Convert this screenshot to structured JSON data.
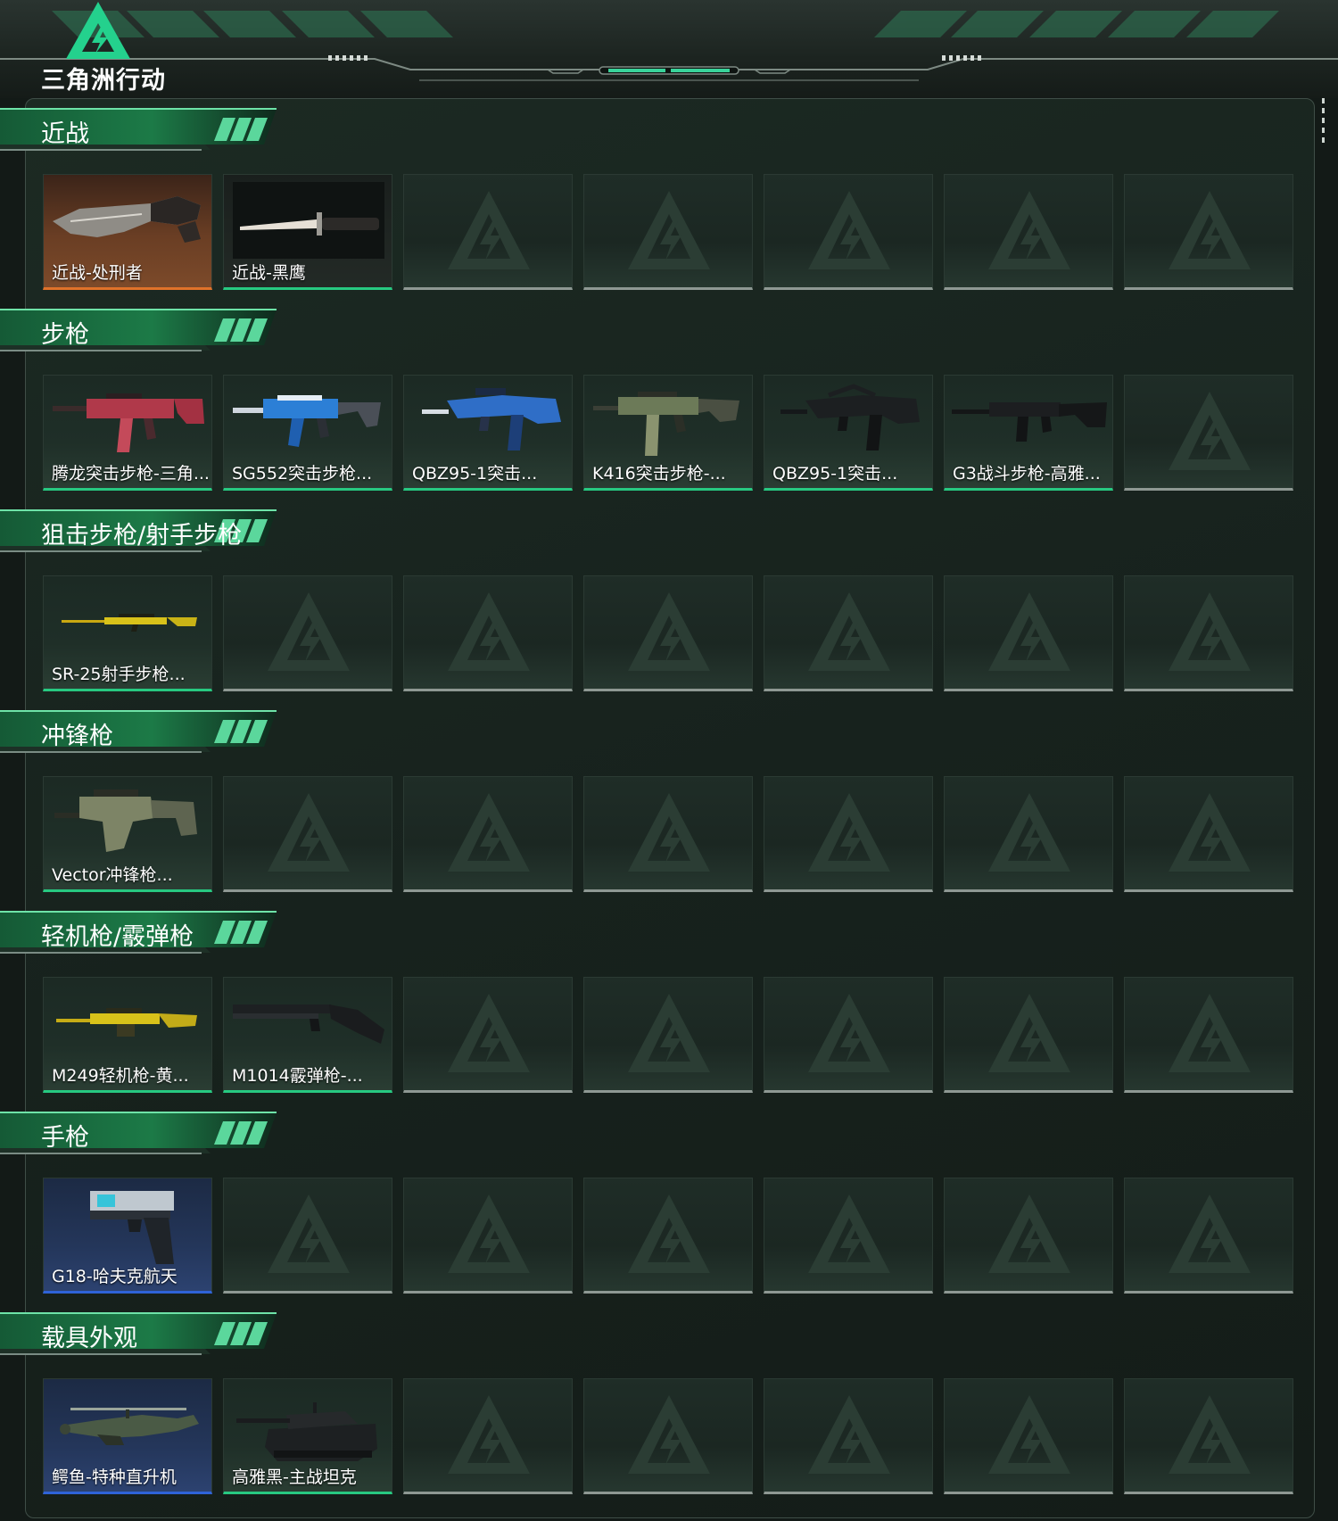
{
  "header": {
    "logo_text": "三角洲行动",
    "logo_icon": "delta-triangle-logo",
    "accent_color": "#27c981"
  },
  "sections": [
    {
      "title": "近战",
      "items": [
        {
          "label": "近战-处刑者",
          "rarity_color": "#e0722a",
          "icon": "combat-knife"
        },
        {
          "label": "近战-黑鹰",
          "rarity_color": "#27c981",
          "icon": "dagger"
        }
      ]
    },
    {
      "title": "步枪",
      "items": [
        {
          "label": "腾龙突击步枪-三角...",
          "rarity_color": "#27c981",
          "icon": "assault-rifle"
        },
        {
          "label": "SG552突击步枪...",
          "rarity_color": "#27c981",
          "icon": "assault-rifle"
        },
        {
          "label": "QBZ95-1突击...",
          "rarity_color": "#27c981",
          "icon": "bullpup-rifle"
        },
        {
          "label": "K416突击步枪-...",
          "rarity_color": "#27c981",
          "icon": "assault-rifle"
        },
        {
          "label": "QBZ95-1突击...",
          "rarity_color": "#27c981",
          "icon": "bullpup-rifle"
        },
        {
          "label": "G3战斗步枪-高雅...",
          "rarity_color": "#27c981",
          "icon": "battle-rifle"
        }
      ]
    },
    {
      "title": "狙击步枪/射手步枪",
      "items": [
        {
          "label": "SR-25射手步枪...",
          "rarity_color": "#27c981",
          "icon": "marksman-rifle"
        }
      ]
    },
    {
      "title": "冲锋枪",
      "items": [
        {
          "label": "Vector冲锋枪...",
          "rarity_color": "#27c981",
          "icon": "smg"
        }
      ]
    },
    {
      "title": "轻机枪/霰弹枪",
      "items": [
        {
          "label": "M249轻机枪-黄...",
          "rarity_color": "#27c981",
          "icon": "light-machine-gun"
        },
        {
          "label": "M1014霰弹枪-...",
          "rarity_color": "#27c981",
          "icon": "shotgun"
        }
      ]
    },
    {
      "title": "手枪",
      "items": [
        {
          "label": "G18-哈夫克航天",
          "rarity_color": "#2f63d8",
          "icon": "pistol"
        }
      ]
    },
    {
      "title": "载具外观",
      "items": [
        {
          "label": "鳄鱼-特种直升机",
          "rarity_color": "#2f63d8",
          "icon": "helicopter"
        },
        {
          "label": "高雅黑-主战坦克",
          "rarity_color": "#27c981",
          "icon": "tank"
        }
      ]
    }
  ],
  "slots_per_row": 7
}
